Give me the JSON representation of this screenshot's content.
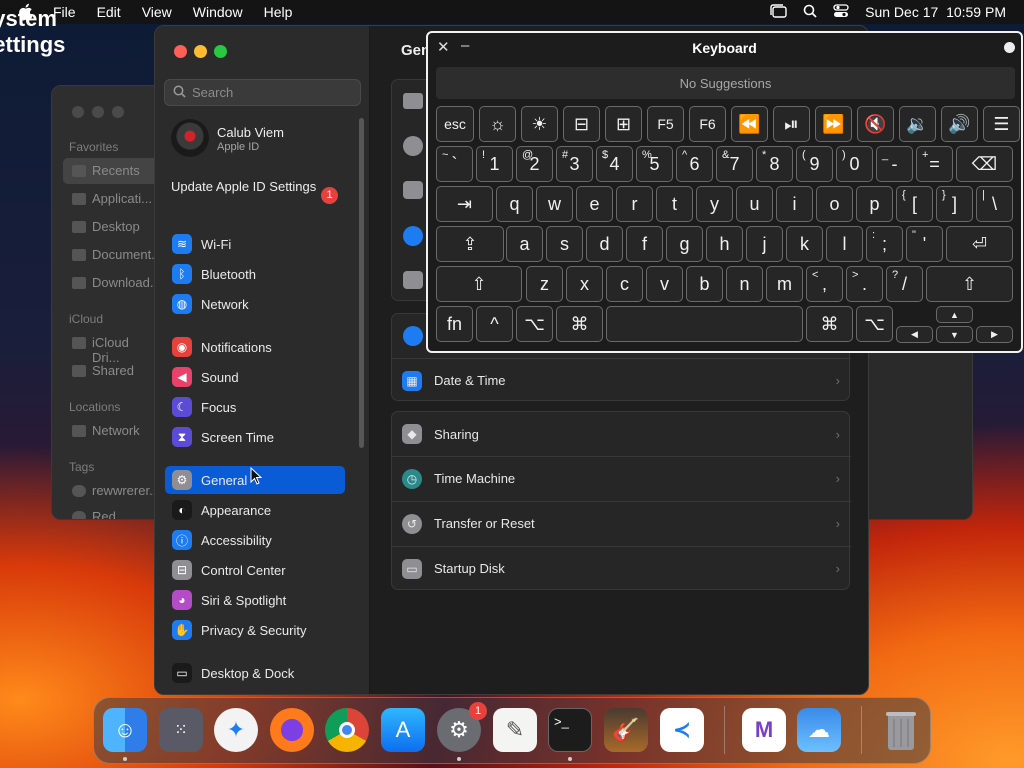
{
  "menubar": {
    "app_name": "System Settings",
    "menus": [
      "File",
      "Edit",
      "View",
      "Window",
      "Help"
    ],
    "clock": "Sun Dec 17  10:59 PM"
  },
  "finder": {
    "sections": [
      "Favorites",
      "iCloud",
      "Locations",
      "Tags"
    ],
    "items": [
      "Recents",
      "Applicati...",
      "Desktop",
      "Document...",
      "Download...",
      "iCloud Dri...",
      "Shared",
      "Network",
      "rewwrerer...",
      "Red"
    ]
  },
  "settings": {
    "search_placeholder": "Search",
    "account_name": "Calub Viem",
    "account_sub": "Apple ID",
    "update_label": "Update Apple ID Settings",
    "update_badge": "1",
    "sidebar": [
      {
        "label": "Wi-Fi",
        "icon": "wifi-icon",
        "color": "#1e7cf2"
      },
      {
        "label": "Bluetooth",
        "icon": "bluetooth-icon",
        "color": "#1e7cf2"
      },
      {
        "label": "Network",
        "icon": "globe-icon",
        "color": "#1e7cf2"
      },
      {
        "label": "Notifications",
        "icon": "bell-icon",
        "color": "#e8413c"
      },
      {
        "label": "Sound",
        "icon": "speaker-icon",
        "color": "#e8416a"
      },
      {
        "label": "Focus",
        "icon": "moon-icon",
        "color": "#5b4bd6"
      },
      {
        "label": "Screen Time",
        "icon": "hourglass-icon",
        "color": "#5b4bd6"
      },
      {
        "label": "General",
        "icon": "gear-icon",
        "color": "#8e8e93"
      },
      {
        "label": "Appearance",
        "icon": "appearance-icon",
        "color": "#1a1a1a"
      },
      {
        "label": "Accessibility",
        "icon": "accessibility-icon",
        "color": "#1e7cf2"
      },
      {
        "label": "Control Center",
        "icon": "control-center-icon",
        "color": "#8e8e93"
      },
      {
        "label": "Siri & Spotlight",
        "icon": "siri-icon",
        "color": "#b44cc7"
      },
      {
        "label": "Privacy & Security",
        "icon": "hand-icon",
        "color": "#1e7cf2"
      },
      {
        "label": "Desktop & Dock",
        "icon": "dock-icon",
        "color": "#1a1a1a"
      }
    ],
    "page_title": "Gen",
    "rows": [
      {
        "label": "Date & Time",
        "icon": "calendar-clock-icon",
        "color": "#1e7cf2"
      },
      {
        "label": "Sharing",
        "icon": "sharing-icon",
        "color": "#8e8e93"
      },
      {
        "label": "Time Machine",
        "icon": "time-machine-icon",
        "color": "#2a8a8a"
      },
      {
        "label": "Transfer or Reset",
        "icon": "reset-icon",
        "color": "#8e8e93"
      },
      {
        "label": "Startup Disk",
        "icon": "disk-icon",
        "color": "#8e8e93"
      }
    ]
  },
  "keyboard": {
    "title": "Keyboard",
    "suggestions": "No Suggestions",
    "keys": {
      "esc": "esc",
      "f5": "F5",
      "f6": "F6",
      "n1": "1",
      "n2": "2",
      "n3": "3",
      "n4": "4",
      "n5": "5",
      "n6": "6",
      "n7": "7",
      "n8": "8",
      "n9": "9",
      "n0": "0",
      "s1": "!",
      "s2": "@",
      "s3": "#",
      "s4": "$",
      "s5": "%",
      "s6": "^",
      "s7": "&",
      "s8": "*",
      "s9": "(",
      "s0": ")",
      "tilde": "~",
      "grave": "`",
      "minus": "-",
      "under": "_",
      "equal": "=",
      "plus": "+",
      "q": "q",
      "w": "w",
      "e": "e",
      "r": "r",
      "t": "t",
      "y": "y",
      "u": "u",
      "i": "i",
      "o": "o",
      "p": "p",
      "lbr": "[",
      "lcb": "{",
      "rbr": "]",
      "rcb": "}",
      "bsl": "\\",
      "pipe": "|",
      "a": "a",
      "s": "s",
      "d": "d",
      "f": "f",
      "g": "g",
      "h": "h",
      "j": "j",
      "k": "k",
      "l": "l",
      "semi": ";",
      "colon": ":",
      "quote": "'",
      "dquote": "\"",
      "z": "z",
      "x": "x",
      "c": "c",
      "v": "v",
      "b": "b",
      "n": "n",
      "m": "m",
      "comma": ",",
      "lt": "<",
      "period": ".",
      "gt": ">",
      "slash": "/",
      "qmark": "?",
      "fn": "fn"
    }
  },
  "dock": {
    "apps": [
      "finder-icon",
      "launchpad-icon",
      "safari-icon",
      "firefox-icon",
      "chrome-icon",
      "app-store-icon",
      "system-settings-icon",
      "textedit-icon",
      "terminal-icon",
      "garageband-icon",
      "vscode-icon",
      "visual-studio-icon",
      "weather-icon",
      "trash-icon"
    ],
    "settings_badge": "1"
  }
}
